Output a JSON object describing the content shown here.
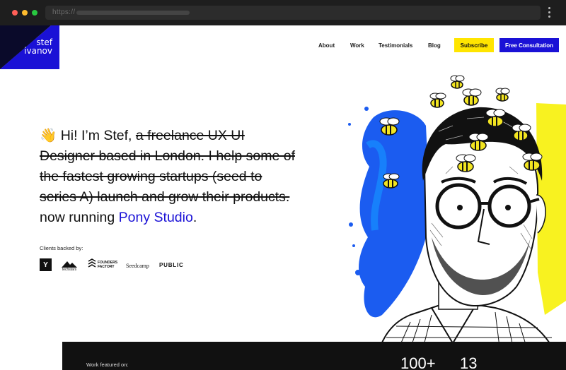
{
  "browser": {
    "url_prefix": "https://"
  },
  "logo": {
    "line1": "stef",
    "line2": "ivanov"
  },
  "nav": {
    "about": "About",
    "work": "Work",
    "testimonials": "Testimonials",
    "blog": "Blog",
    "subscribe": "Subscribe",
    "consultation": "Free Consultation"
  },
  "hero": {
    "emoji": "👋",
    "greeting": "Hi! I’m Stef,",
    "struck": "a freelance UX UI Designer based in London. I help some of the fastest growing startups (seed to series A) launch and grow their products.",
    "now": "now running",
    "studio": "Pony Studio",
    "period": "."
  },
  "clients": {
    "label": "Clients backed by:",
    "yc": "Y",
    "techstars": "techstars",
    "founders_factory": "FOUNDERS FACTORY",
    "seedcamp": "Seedcamp",
    "public": "PUBLIC"
  },
  "footer": {
    "featured": "Work featured on:",
    "stat1": "100+",
    "stat2": "13"
  },
  "colors": {
    "brand_blue": "#1a11d6",
    "accent_yellow": "#ffe500"
  }
}
